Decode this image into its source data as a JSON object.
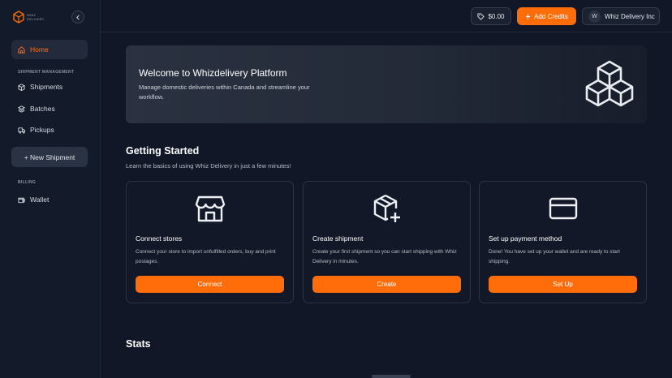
{
  "brand": {
    "logo_text": "WHIZ\nDELIVERY",
    "accent": "#ff6d0a"
  },
  "sidebar": {
    "home": "Home",
    "shipment_section": "SHIPMENT MANAGEMENT",
    "shipments": "Shipments",
    "batches": "Batches",
    "pickups": "Pickups",
    "new_shipment": "+ New Shipment",
    "billing_section": "BILLING",
    "wallet": "Wallet"
  },
  "topbar": {
    "balance": "$0.00",
    "add_credits": "Add Credits",
    "avatar_initial": "W",
    "account_name": "Whiz Delivery Inc"
  },
  "banner": {
    "title": "Welcome to Whizdelivery Platform",
    "description": "Manage domestic deliveries within Canada and streamline your workflow."
  },
  "getting_started": {
    "title": "Getting Started",
    "subtitle": "Learn the basics of using Whiz Delivery in just a few minutes!",
    "cards": [
      {
        "title": "Connect stores",
        "description": "Connect your store to import unfulfilled orders, buy and print postages.",
        "button": "Connect",
        "icon": "store-icon"
      },
      {
        "title": "Create shipment",
        "description": "Create your first shipment so you can start shipping with Whiz Delivery in minutes.",
        "button": "Create",
        "icon": "package-plus-icon"
      },
      {
        "title": "Set up payment method",
        "description": "Done! You have set up your wallet and are ready to start shipping.",
        "button": "Set Up",
        "icon": "credit-card-icon"
      }
    ]
  },
  "stats": {
    "title": "Stats"
  }
}
